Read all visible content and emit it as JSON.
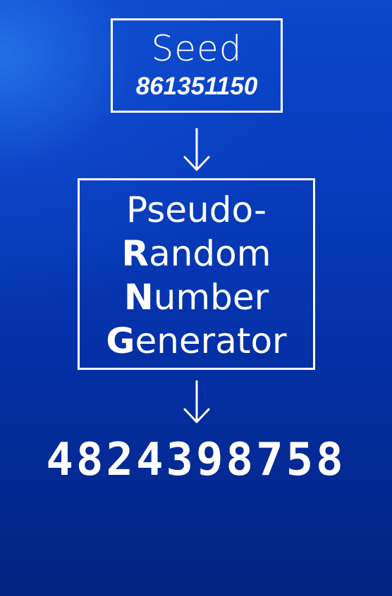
{
  "seed": {
    "title": "Seed",
    "value": "861351150"
  },
  "prng": {
    "line_1": "Pseudo-",
    "line_2": {
      "initial": "R",
      "rest": "andom"
    },
    "line_3": {
      "initial": "N",
      "rest": "umber"
    },
    "line_4": {
      "initial": "G",
      "rest": "enerator"
    }
  },
  "output": {
    "number": "4824398758"
  },
  "arrows": [
    "down-arrow-icon",
    "down-arrow-icon"
  ],
  "colors": {
    "background_top": "#0b48cc",
    "background_bottom": "#02237f",
    "foreground": "#ffffff"
  }
}
